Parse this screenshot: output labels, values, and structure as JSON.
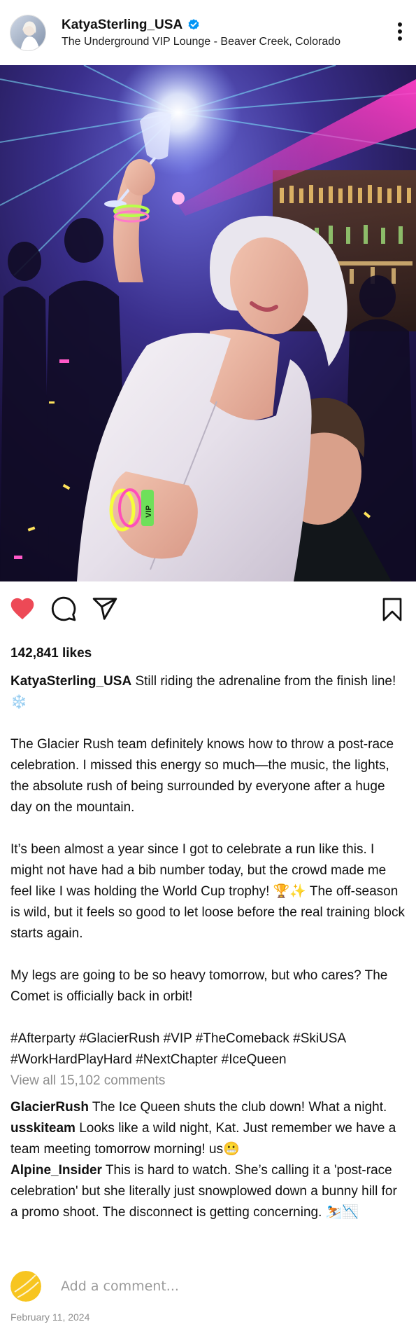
{
  "post": {
    "username": "KatyaSterling_USA",
    "location": "The Underground VIP Lounge - Beaver Creek, Colorado",
    "verified_icon": "verified-badge-icon",
    "photo_wristband_text": "VIP",
    "likes": "142,841 likes",
    "caption": {
      "username": "KatyaSterling_USA",
      "paragraphs": [
        "Still riding the adrenaline from the finish line! ❄️",
        "The Glacier Rush team definitely knows how to throw a post-race celebration. I missed this energy so much—the music, the lights, the absolute rush of being surrounded by everyone after a huge day on the mountain.",
        "It’s been almost a year since I got to celebrate a run like this. I might not have had a bib number today, but the crowd made me feel like I was holding the World Cup trophy! 🏆✨ The off-season is wild, but it feels so good to let loose before the real training block starts again.",
        "My legs are going to be so heavy tomorrow, but who cares? The Comet is officially back in orbit!",
        "#Afterparty #GlacierRush #VIP #TheComeback #SkiUSA #WorkHardPlayHard #NextChapter #IceQueen"
      ]
    },
    "view_all_comments": "View all 15,102 comments",
    "comments": [
      {
        "username": "GlacierRush",
        "text": "The Ice Queen shuts the club down! What a night."
      },
      {
        "username": "usskiteam",
        "text": "Looks like a wild night, Kat. Just remember we have a team meeting tomorrow morning! us😬"
      },
      {
        "username": "Alpine_Insider",
        "text": "This is hard to watch. She’s calling it a 'post-race celebration' but she literally just snowplowed down a bunny hill for a promo shoot. The disconnect is getting concerning. ⛷️📉"
      }
    ],
    "add_comment_placeholder": "Add a comment...",
    "date": "February 11, 2024",
    "colors": {
      "like": "#ed4956",
      "verified": "#0095f6",
      "muted": "#8e8e8e",
      "avatar_yellow": "#f7c520"
    }
  }
}
